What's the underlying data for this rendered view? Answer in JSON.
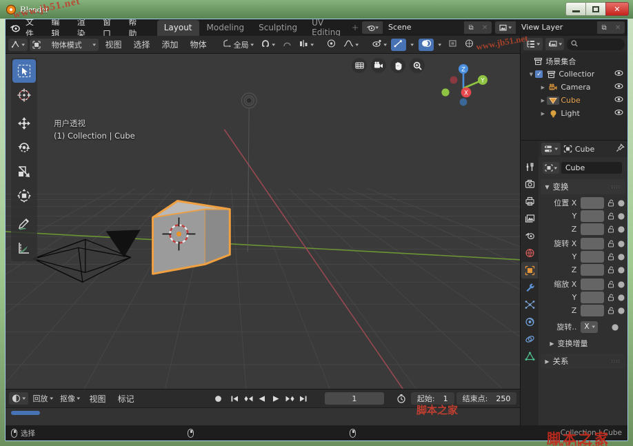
{
  "window": {
    "title": "Blender",
    "logo_icon": "blender-logo-icon",
    "minimize_label": "minimize-icon",
    "maximize_label": "maximize-icon",
    "close_label": "✕"
  },
  "topbar": {
    "app_icon": "blender-menu-icon",
    "menus": [
      "文件",
      "编辑",
      "渲染",
      "窗口",
      "帮助"
    ],
    "workspace_tabs": [
      {
        "label": "Layout",
        "active": true
      },
      {
        "label": "Modeling",
        "active": false
      },
      {
        "label": "Sculpting",
        "active": false
      },
      {
        "label": "UV Editing",
        "active": false
      }
    ],
    "workspace_add": "+",
    "scene": {
      "icon": "scene-icon",
      "name": "Scene",
      "new_btn": "copy-icon",
      "unlink_btn": "✕"
    },
    "view_layer": {
      "icon": "view-layer-icon",
      "name": "View Layer",
      "new_btn": "copy-icon",
      "unlink_btn": "✕"
    }
  },
  "viewport_header": {
    "editor_type_icon": "editor-type-3dview-icon",
    "mode": "物体模式",
    "mode_icon": "object-mode-icon",
    "menus": [
      "视图",
      "选择",
      "添加",
      "物体"
    ],
    "transform_orientation": {
      "icon": "orientation-icon",
      "label": "全局"
    },
    "snap_icon": "magnet-icon",
    "proportional_icon": "proportional-edit-icon",
    "proportional_falloff_icon": "falloff-curve-icon",
    "pivot_icon": "pivot-point-icon",
    "snap_target_icon": "snap-target-icon",
    "visibility_icon": "object-visibility-icon",
    "gizmo_icon": "gizmo-icon",
    "overlays_icon": "overlays-icon",
    "xray_icon": "xray-icon",
    "shading_solid_icon": "shading-solid-icon",
    "shading_material_icon": "shading-material-icon",
    "shading_rendered_icon": "shading-rendered-icon"
  },
  "viewport": {
    "view_name": "用户透视",
    "collection_object": "(1) Collection | Cube",
    "tools": [
      {
        "name": "tweak-tool",
        "icon": "cursor-arrow-icon",
        "active": true
      },
      {
        "name": "cursor-tool",
        "icon": "3d-cursor-icon",
        "active": false
      },
      {
        "name": "move-tool",
        "icon": "move-arrows-icon",
        "active": false
      },
      {
        "name": "rotate-tool",
        "icon": "rotate-icon",
        "active": false
      },
      {
        "name": "scale-tool",
        "icon": "scale-icon",
        "active": false
      },
      {
        "name": "transform-tool",
        "icon": "transform-icon",
        "active": false
      },
      {
        "name": "annotate-tool",
        "icon": "pencil-icon",
        "active": false
      },
      {
        "name": "measure-tool",
        "icon": "ruler-icon",
        "active": false
      }
    ],
    "nav_buttons": [
      {
        "name": "toggle-camera-perspective",
        "icon": "grid-perspective-icon"
      },
      {
        "name": "toggle-camera-view",
        "icon": "camera-icon"
      },
      {
        "name": "move-view",
        "icon": "hand-icon"
      },
      {
        "name": "zoom-view",
        "icon": "magnifier-plus-icon"
      }
    ],
    "gizmo_axes": [
      {
        "label": "Z",
        "color": "#4a8fe0"
      },
      {
        "label": "Y",
        "color": "#8fc442"
      },
      {
        "label": "X",
        "color": "#e5484d"
      }
    ],
    "objects": [
      "Cube",
      "Camera",
      "Light"
    ],
    "grid_color": "#4a4a4a",
    "x_axis_color": "#9c4a52",
    "y_axis_color": "#6b8f39",
    "selection_color": "#e99a2b"
  },
  "timeline": {
    "editor_icon": "timeline-editor-icon",
    "menus": [
      "回放",
      "抠像",
      "视图",
      "标记"
    ],
    "record_icon": "record-icon",
    "transport": [
      {
        "name": "jump-to-start",
        "icon": "⏮"
      },
      {
        "name": "prev-keyframe",
        "icon": "◀◆"
      },
      {
        "name": "play-reverse",
        "icon": "◀"
      },
      {
        "name": "play",
        "icon": "▶"
      },
      {
        "name": "next-keyframe",
        "icon": "◆▶"
      },
      {
        "name": "jump-to-end",
        "icon": "⏭"
      }
    ],
    "current_frame": "1",
    "sync_icon": "stopwatch-icon",
    "start_label": "起始:",
    "start_value": "1",
    "end_label": "结束点:",
    "end_value": "250"
  },
  "outliner": {
    "display_mode_icon": "outliner-display-mode-icon",
    "filter_icon": "outliner-filter-icon",
    "search_placeholder": "",
    "search_icon": "search-icon",
    "scene_collection": {
      "label": "场景集合",
      "icon": "collection-icon"
    },
    "rows": [
      {
        "label": "Collection",
        "icon": "collection-icon",
        "depth": 0,
        "checkbox": true,
        "disclosure": "▼",
        "selected": false,
        "eye": "eye-icon"
      },
      {
        "label": "Camera",
        "icon": "camera-object-icon",
        "depth": 1,
        "checkbox": false,
        "disclosure": "▶",
        "selected": false,
        "eye": "eye-icon"
      },
      {
        "label": "Cube",
        "icon": "mesh-object-icon",
        "depth": 1,
        "checkbox": false,
        "disclosure": "▶",
        "selected": true,
        "eye": "eye-icon"
      },
      {
        "label": "Light",
        "icon": "light-object-icon",
        "depth": 1,
        "checkbox": false,
        "disclosure": "▶",
        "selected": false,
        "eye": "eye-icon"
      }
    ]
  },
  "properties": {
    "editor_icon": "properties-editor-icon",
    "breadcrumb_icon": "object-icon",
    "breadcrumb_label": "Cube",
    "pin_icon": "pin-icon",
    "tabs": [
      {
        "name": "tool-tab",
        "icon": "tool-wrench-screwdriver-icon",
        "active": false,
        "color": "#d9d9d9"
      },
      {
        "name": "render-tab",
        "icon": "camera-back-icon",
        "active": false,
        "color": "#d0d0d0"
      },
      {
        "name": "output-tab",
        "icon": "printer-icon",
        "active": false,
        "color": "#d0d0d0"
      },
      {
        "name": "view-layer-tab",
        "icon": "images-icon",
        "active": false,
        "color": "#d0d0d0"
      },
      {
        "name": "scene-tab",
        "icon": "cone-sphere-icon",
        "active": false,
        "color": "#d0d0d0"
      },
      {
        "name": "world-tab",
        "icon": "world-globe-icon",
        "active": false,
        "color": "#d05b5b"
      },
      {
        "name": "object-tab",
        "icon": "object-square-icon",
        "active": true,
        "color": "#e2953a"
      },
      {
        "name": "modifiers-tab",
        "icon": "wrench-icon",
        "active": false,
        "color": "#5b8fd0"
      },
      {
        "name": "particles-tab",
        "icon": "particles-icon",
        "active": false,
        "color": "#7ba3d6"
      },
      {
        "name": "physics-tab",
        "icon": "physics-orbit-icon",
        "active": false,
        "color": "#6e9fd8"
      },
      {
        "name": "constraints-tab",
        "icon": "constraint-icon",
        "active": false,
        "color": "#6e9fd8"
      },
      {
        "name": "data-tab",
        "icon": "mesh-data-triangle-icon",
        "active": false,
        "color": "#4fbd8a"
      }
    ],
    "object_name_icon": "object-icon",
    "object_name": "Cube",
    "panels": [
      {
        "title": "变换",
        "open": true,
        "groups": [
          {
            "label": "位置 X",
            "rows": [
              {
                "label": "位置 X",
                "value": ""
              },
              {
                "label": "Y",
                "value": ""
              },
              {
                "label": "Z",
                "value": ""
              }
            ]
          },
          {
            "label": "旋转 X",
            "rows": [
              {
                "label": "旋转 X",
                "value": ""
              },
              {
                "label": "Y",
                "value": ""
              },
              {
                "label": "Z",
                "value": ""
              }
            ]
          },
          {
            "label": "缩放 X",
            "rows": [
              {
                "label": "缩放 X",
                "value": ""
              },
              {
                "label": "Y",
                "value": ""
              },
              {
                "label": "Z",
                "value": ""
              }
            ]
          }
        ],
        "rotation_mode": {
          "label": "旋转..",
          "value": "X"
        }
      },
      {
        "title": "变换增量",
        "open": false
      },
      {
        "title": "关系",
        "open": false
      }
    ],
    "lock_icon": "lock-open-icon",
    "animate_icon": "animate-dot-icon"
  },
  "statusbar": {
    "left_mouse_icon": "mouse-left-icon",
    "left_label": "选择",
    "middle_mouse_icon": "mouse-middle-icon",
    "right_mouse_icon": "mouse-right-icon",
    "right_text": "Collection | Cube"
  },
  "watermarks": {
    "site1": "www.jb51.net",
    "site2": "www.jb51.net",
    "brand_cn": "脚本之家",
    "brand_url": "www.jb51.net"
  }
}
